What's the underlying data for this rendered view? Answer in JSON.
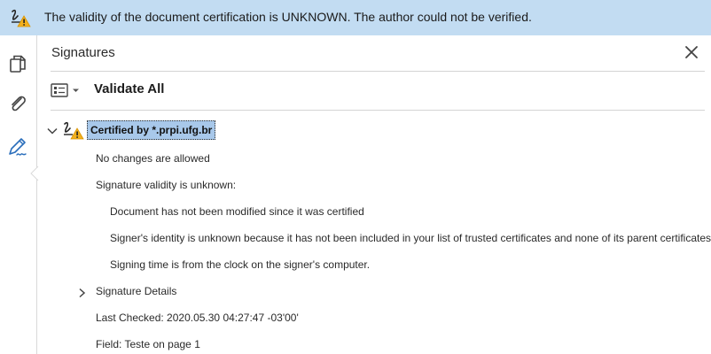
{
  "banner": {
    "message": "The validity of the document certification is UNKNOWN. The author could not be verified.",
    "icon": "signature-warning-icon"
  },
  "rail": {
    "items": [
      {
        "icon": "page-thumbnails-icon"
      },
      {
        "icon": "attachment-icon"
      },
      {
        "icon": "signature-pen-icon",
        "active": true
      }
    ]
  },
  "panel": {
    "title": "Signatures",
    "validate_all_label": "Validate All"
  },
  "signature": {
    "certified_by": "Certified by *.prpi.ufg.br",
    "changes": "No changes are allowed",
    "validity": "Signature validity is unknown:",
    "details": [
      "Document has not been modified since it was certified",
      "Signer's identity is unknown because it has not been included in your list of trusted certificates and none of its parent certificates",
      "Signing time is from the clock on the signer's computer."
    ],
    "signature_details_label": "Signature Details",
    "last_checked": "Last Checked: 2020.05.30 04:27:47 -03'00'",
    "field": "Field: Teste on page 1"
  },
  "colors": {
    "banner_bg": "#c2dcf2",
    "selection_bg": "#a8c8ea",
    "accent_blue": "#2a6ebb",
    "warning_yellow": "#f2b01e"
  }
}
